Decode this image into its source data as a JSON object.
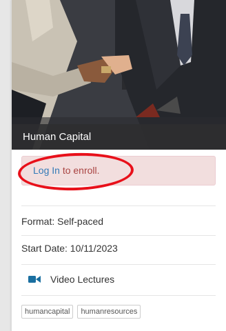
{
  "course": {
    "title": "Human Capital"
  },
  "enroll_alert": {
    "login_link": "Log In",
    "suffix": " to enroll."
  },
  "details": {
    "format": "Format: Self-paced",
    "start_date": "Start Date: 10/11/2023",
    "video_lectures": "Video Lectures"
  },
  "tags": [
    "humancapital",
    "humanresources"
  ],
  "colors": {
    "alert_bg": "#f2dede",
    "alert_text": "#a94442",
    "link": "#337ab7",
    "annotation": "#e8101a",
    "video_icon": "#1a6fa0"
  },
  "icons": {
    "video": "video-camera-icon"
  }
}
